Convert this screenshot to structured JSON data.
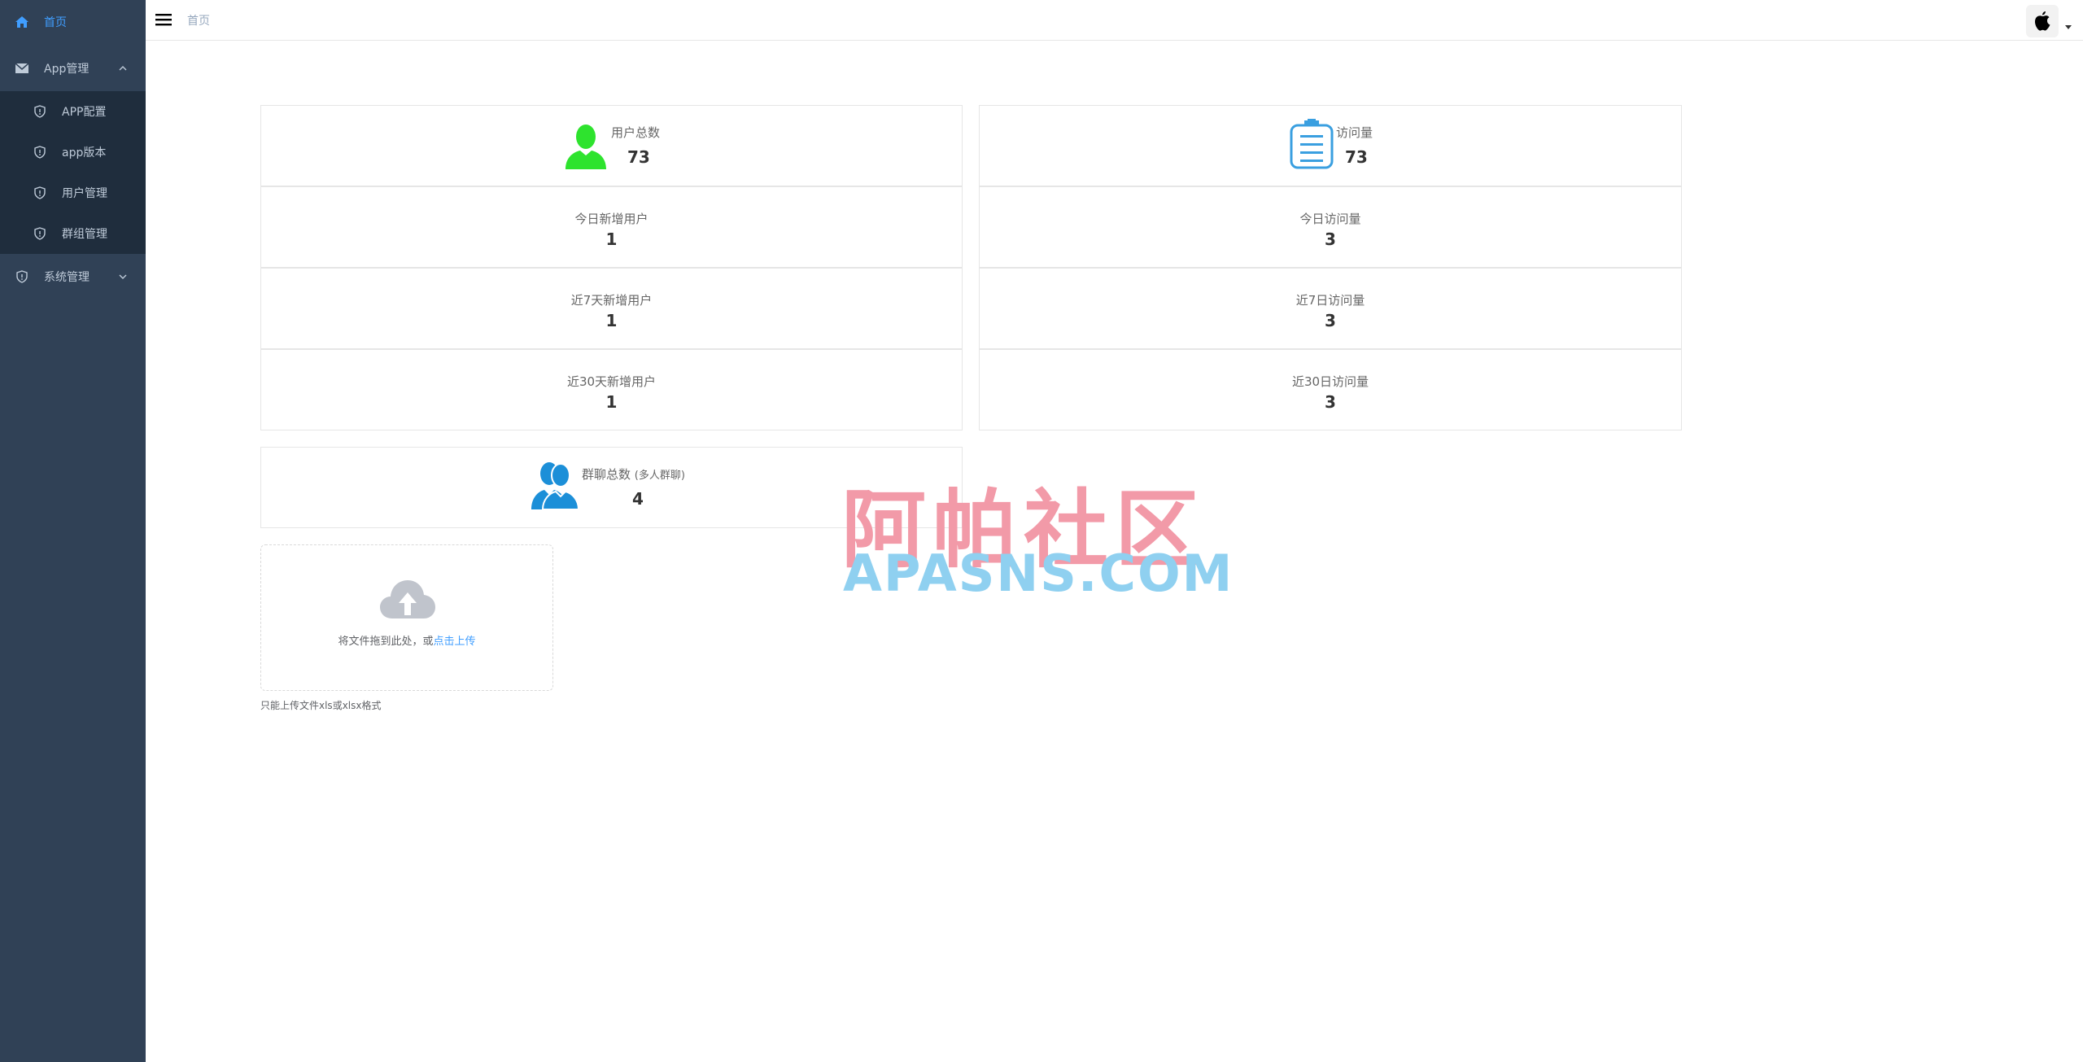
{
  "sidebar": {
    "home": "首页",
    "app_group": "App管理",
    "items": [
      "APP配置",
      "app版本",
      "用户管理",
      "群组管理"
    ],
    "system": "系统管理"
  },
  "header": {
    "breadcrumb": "首页"
  },
  "stats": {
    "total_users_label": "用户总数",
    "total_users": "73",
    "visits_label": "访问量",
    "visits": "73",
    "today_new_users_label": "今日新增用户",
    "today_new_users": "1",
    "today_visits_label": "今日访问量",
    "today_visits": "3",
    "week_new_users_label": "近7天新增用户",
    "week_new_users": "1",
    "week_visits_label": "近7日访问量",
    "week_visits": "3",
    "month_new_users_label": "近30天新增用户",
    "month_new_users": "1",
    "month_visits_label": "近30日访问量",
    "month_visits": "3",
    "groups_label": "群聊总数",
    "groups_note": "(多人群聊)",
    "groups": "4"
  },
  "upload": {
    "drag_text": "将文件拖到此处，或",
    "click_text": "点击上传",
    "tip": "只能上传文件xls或xlsx格式"
  },
  "watermark": {
    "cn": "阿帕社区",
    "en": "APASNS.COM"
  },
  "colors": {
    "sidebar_bg": "#304156",
    "submenu_bg": "#1f2d3d",
    "accent": "#409eff",
    "user_icon": "#2ee32e",
    "group_icon": "#1c8fd8"
  }
}
